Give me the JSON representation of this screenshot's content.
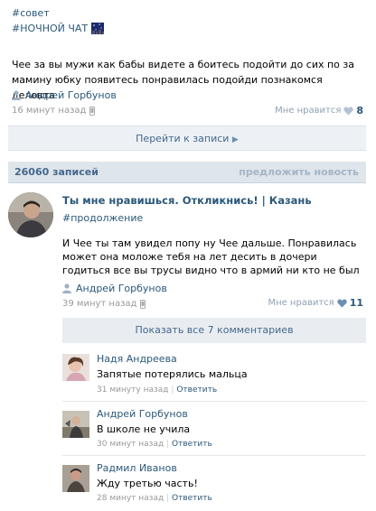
{
  "post1": {
    "hashtag": "#совет",
    "title": "#НОЧНОЙ ЧАТ",
    "text": "Чее за вы мужи как бабы видете а боитесь подойти до сих по за мамину юбку появитесь понравилась подойди познакомся деловта",
    "author": "Андрей Горбунов",
    "time": "16 минут назад",
    "likes_label": "Мне нравится",
    "likes_count": "8",
    "goto_label": "Перейти к записи"
  },
  "wall": {
    "count_label": "26060 записей",
    "suggest_label": "предложить новость"
  },
  "post2": {
    "group_title": "Ты мне нравишься. Откликнись! | Казань",
    "hashtag": "#продолжение",
    "text": "И Чее ты там увидел попу ну Чее дальше. Понравилась может она моложе тебя на лет десить в дочери годиться все вы трусы видно что в армий ни кто не был",
    "author": "Андрей Горбунов",
    "time": "39 минут назад",
    "likes_label": "Мне нравится",
    "likes_count": "11",
    "show_all_label": "Показать все 7 комментариев"
  },
  "comments": [
    {
      "name": "Надя Андреева",
      "text": "Запятые потерялись мальца",
      "time": "31 минуту назад",
      "reply": "Ответить"
    },
    {
      "name": "Андрей Горбунов",
      "text": "В школе не учила",
      "time": "30 минут назад",
      "reply": "Ответить"
    },
    {
      "name": "Радмил Иванов",
      "text": "Жду третью часть!",
      "time": "28 минут назад",
      "reply": "Ответить"
    }
  ],
  "colors": {
    "link": "#2b587a",
    "header_bg": "#dee5eb",
    "bar_bg": "#edf1f5"
  }
}
